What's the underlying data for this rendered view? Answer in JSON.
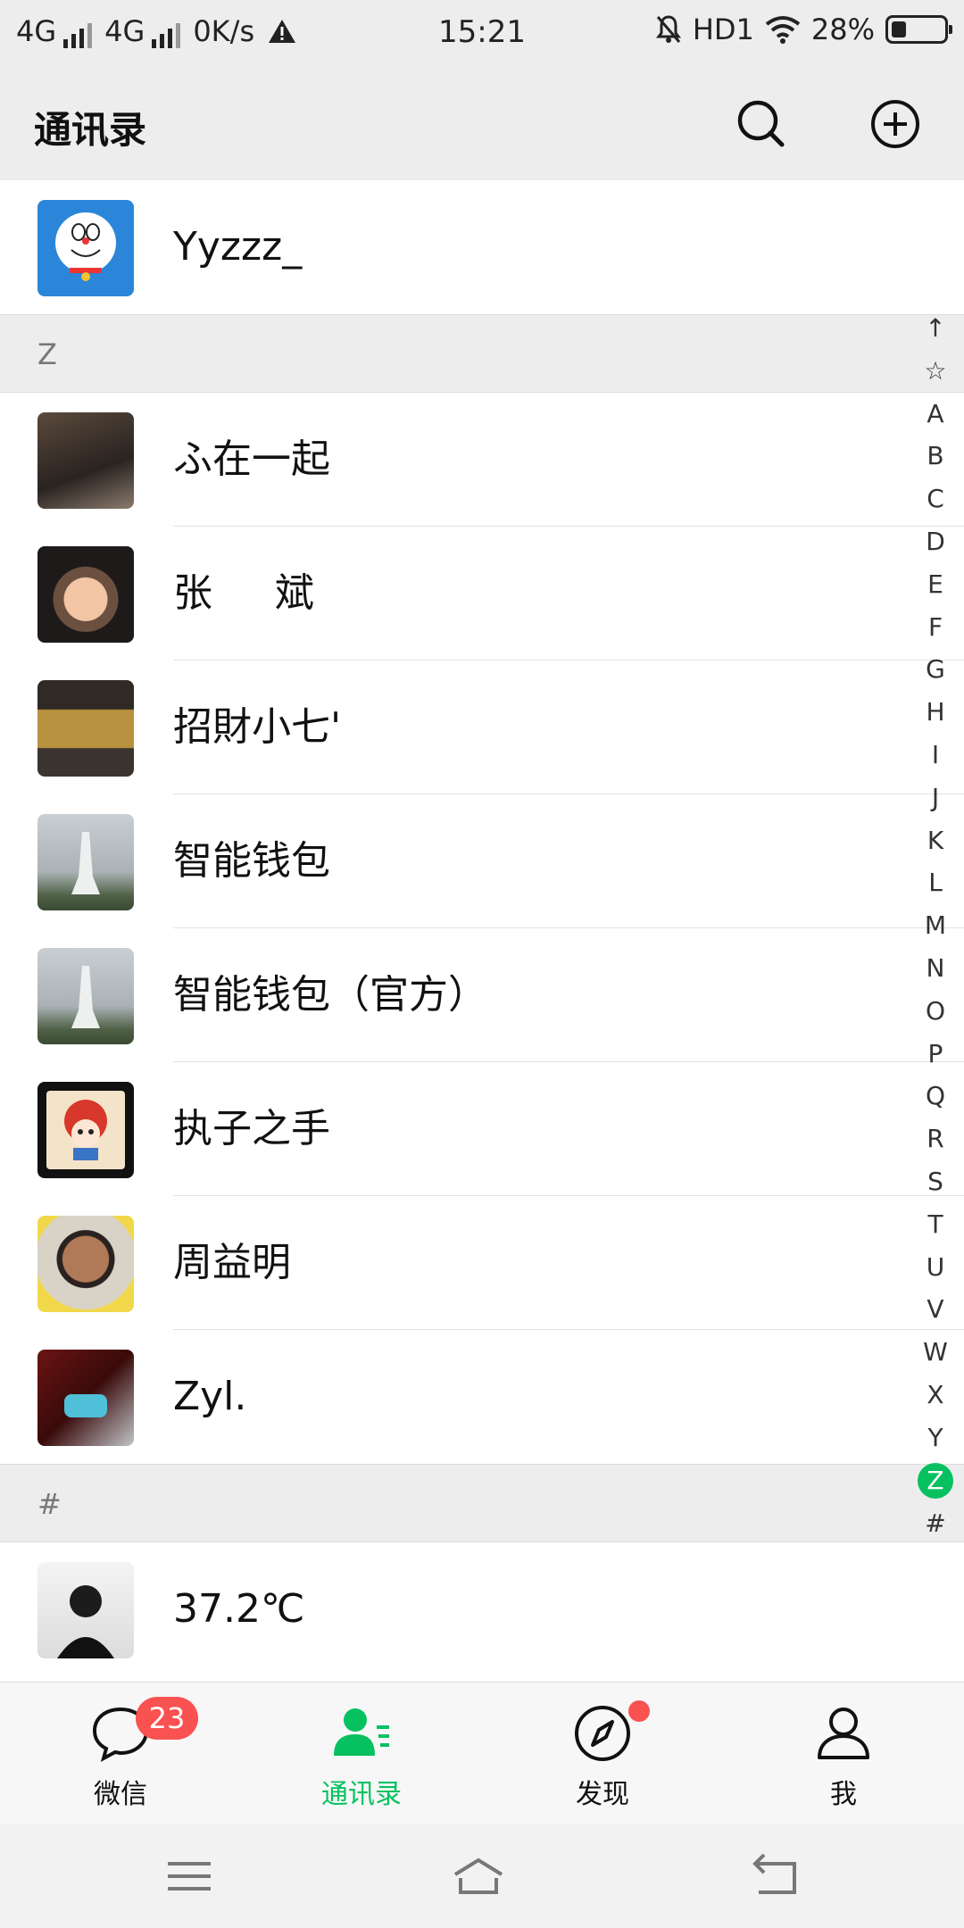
{
  "status_bar": {
    "network1": "4G",
    "network2": "4G",
    "speed": "0K/s",
    "time": "15:21",
    "hd": "HD1",
    "battery_text": "28%",
    "battery_level": 0.28
  },
  "header": {
    "title": "通讯录"
  },
  "contacts": {
    "top": {
      "name": "Yyzzz_"
    },
    "sections": [
      {
        "letter": "Z",
        "items": [
          {
            "name": "ふ在一起"
          },
          {
            "name": "张     斌"
          },
          {
            "name": "招財小七'"
          },
          {
            "name": "智能钱包"
          },
          {
            "name": "智能钱包（官方）"
          },
          {
            "name": "执子之手"
          },
          {
            "name": "周益明"
          },
          {
            "name": "Zyl."
          }
        ]
      },
      {
        "letter": "#",
        "items": [
          {
            "name": "37.2℃"
          }
        ]
      }
    ]
  },
  "index_bar": {
    "letters": [
      "↑",
      "☆",
      "A",
      "B",
      "C",
      "D",
      "E",
      "F",
      "G",
      "H",
      "I",
      "J",
      "K",
      "L",
      "M",
      "N",
      "O",
      "P",
      "Q",
      "R",
      "S",
      "T",
      "U",
      "V",
      "W",
      "X",
      "Y",
      "Z",
      "#"
    ],
    "active": "Z"
  },
  "tabs": [
    {
      "label": "微信",
      "badge": "23"
    },
    {
      "label": "通讯录"
    },
    {
      "label": "发现"
    },
    {
      "label": "我"
    }
  ],
  "colors": {
    "accent": "#07c160",
    "badge": "#fa5151",
    "header_bg": "#ededed"
  }
}
